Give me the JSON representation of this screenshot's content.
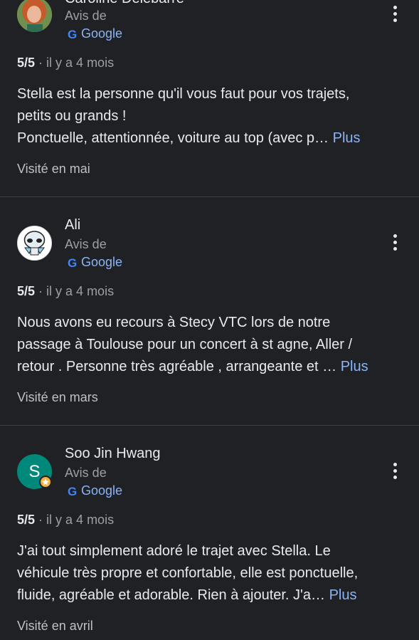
{
  "colors": {
    "background": "#202124",
    "link": "#8ab4f8",
    "secondary_text": "#9aa0a6",
    "divider": "#3c4043",
    "initial_avatar": "#00897b"
  },
  "reviews": [
    {
      "name": "Caroline Delebarre",
      "avis_label": "Avis de",
      "source": "Google",
      "score": "5/5",
      "time": "· il y a 4 mois",
      "text_lines": [
        "Stella est la personne qu'il vous faut pour vos trajets,",
        "petits ou grands !",
        "Ponctuelle, attentionnée, voiture au top (avec p…"
      ],
      "more_label": "Plus",
      "visit": "Visité en mai",
      "avatar_icon": "profile-photo"
    },
    {
      "name": "Ali",
      "avis_label": "Avis de",
      "source": "Google",
      "score": "5/5",
      "time": "· il y a 4 mois",
      "text_lines": [
        "Nous avons eu recours à Stecy VTC lors de notre",
        "passage à Toulouse pour un concert à st agne, Aller /",
        "retour . Personne très agréable , arrangeante et …"
      ],
      "more_label": "Plus",
      "visit": "Visité en mars",
      "avatar_icon": "alien-avatar"
    },
    {
      "name": "Soo Jin Hwang",
      "avis_label": "Avis de",
      "source": "Google",
      "score": "5/5",
      "time": "· il y a 4 mois",
      "text_lines": [
        "J'ai tout simplement adoré le trajet avec Stella. Le",
        "véhicule très propre et confortable, elle est ponctuelle,",
        "fluide, agréable et adorable. Rien à ajouter. J'a…"
      ],
      "more_label": "Plus",
      "visit": "Visité en avril",
      "avatar_initial": "S",
      "avatar_icon": "local-guide-badge"
    }
  ]
}
